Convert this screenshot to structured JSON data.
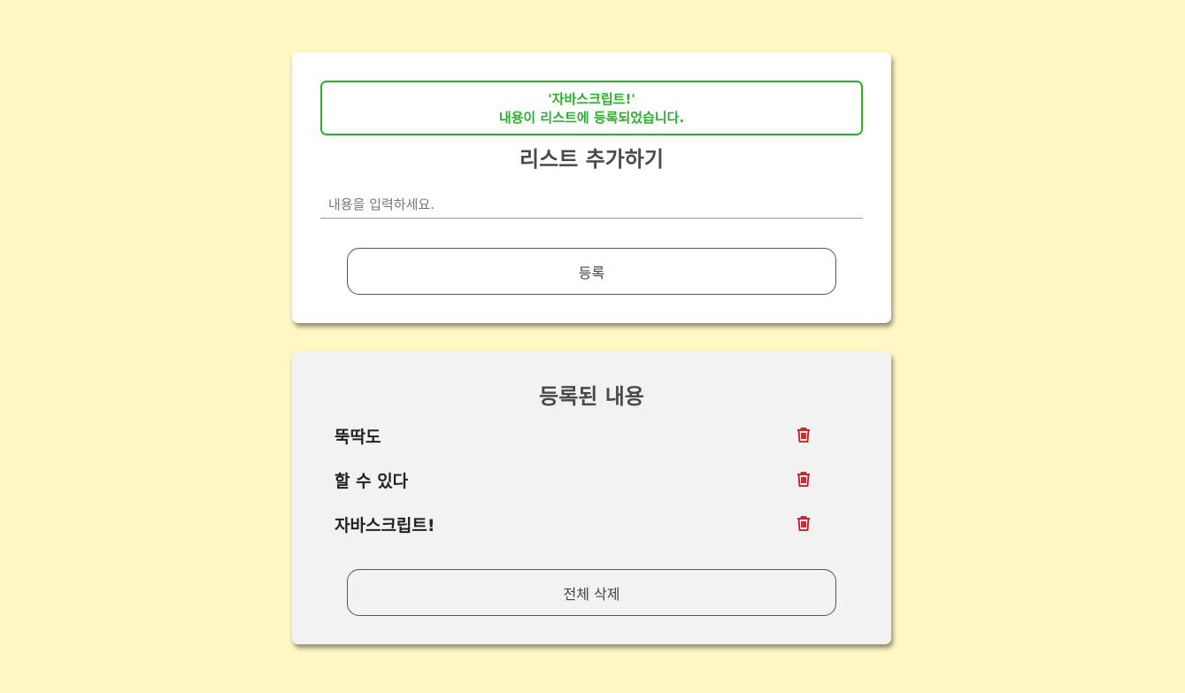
{
  "notice": {
    "line1": "'자바스크립트!'",
    "line2": "내용이 리스트에 등록되었습니다."
  },
  "add_card": {
    "title": "리스트 추가하기",
    "input_placeholder": "내용을 입력하세요.",
    "input_value": "",
    "submit_label": "등록"
  },
  "list_card": {
    "title": "등록된 내용",
    "items": [
      {
        "text": "뚝딱도",
        "icon": "trash-icon"
      },
      {
        "text": "할 수 있다",
        "icon": "trash-icon"
      },
      {
        "text": "자바스크립트!",
        "icon": "trash-icon"
      }
    ],
    "clear_label": "전체 삭제"
  },
  "colors": {
    "background": "#fff8c5",
    "success": "#2bb02b",
    "delete_icon": "#d0121b"
  }
}
